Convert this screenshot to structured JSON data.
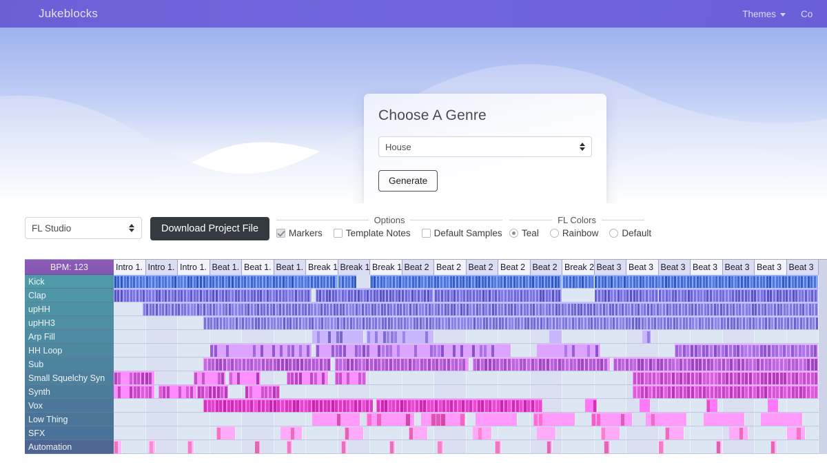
{
  "navbar": {
    "brand": "Jukeblocks",
    "links": [
      {
        "label": "Themes",
        "icon": "chevron-down-icon"
      },
      {
        "label": "Co"
      }
    ]
  },
  "hero": {
    "card": {
      "title": "Choose A Genre",
      "genre_select": {
        "value": "House",
        "icon": "select-spinner-icon"
      },
      "generate_label": "Generate"
    }
  },
  "toolbar": {
    "daw_select": {
      "value": "FL Studio",
      "icon": "select-spinner-icon"
    },
    "download_label": "Download Project File",
    "options": {
      "legend": "Options",
      "items": [
        {
          "label": "Markers",
          "checked": true
        },
        {
          "label": "Template Notes",
          "checked": false
        },
        {
          "label": "Default Samples",
          "checked": false
        }
      ]
    },
    "fl_colors": {
      "legend": "FL Colors",
      "items": [
        {
          "label": "Teal",
          "selected": true
        },
        {
          "label": "Rainbow",
          "selected": false
        },
        {
          "label": "Default",
          "selected": false
        }
      ]
    }
  },
  "sequencer": {
    "bpm_label": "BPM: 123",
    "markers": [
      "Intro 1.",
      "Intro 1.",
      "Intro 1.",
      "Beat 1.",
      "Beat 1.",
      "Beat 1.",
      "Break 1",
      "Break 1",
      "Break 1",
      "Beat 2",
      "Beat 2",
      "Beat 2",
      "Beat 2",
      "Beat 2",
      "Break 2",
      "Beat 3",
      "Beat 3",
      "Beat 3",
      "Beat 3",
      "Beat 3",
      "Beat 3",
      "Beat 3"
    ],
    "tracks": [
      {
        "name": "Kick",
        "color": "#4a6ed0"
      },
      {
        "name": "Clap",
        "color": "#6e6ad8"
      },
      {
        "name": "upHH",
        "color": "#7b76dc"
      },
      {
        "name": "upHH3",
        "color": "#8079de"
      },
      {
        "name": "Arp Fill",
        "color": "#8f7ce0"
      },
      {
        "name": "HH Loop",
        "color": "#a濃"
      },
      {
        "name": "Sub",
        "color": "#b05fd2"
      },
      {
        "name": "Small Squelchy Syn",
        "color": "#c455cc"
      },
      {
        "name": "Synth",
        "color": "#cb52c8"
      },
      {
        "name": "Vox",
        "color": "#de3fbe"
      },
      {
        "name": "Low Thing",
        "color": "#ef5fc0"
      },
      {
        "name": "SFX",
        "color": "#f471bf"
      },
      {
        "name": "Automation",
        "color": "#f77cc2"
      }
    ],
    "label_colors": {
      "top": "#4f9aa8",
      "bottom": "#4a6d95",
      "automation": "#4d6590"
    },
    "accent_purple": "#6b5fd6",
    "accent_dark": "#343a40"
  }
}
